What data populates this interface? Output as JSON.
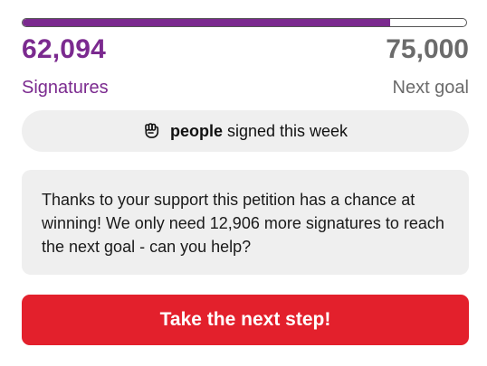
{
  "progress": {
    "fraction": 0.828,
    "fill_color": "#7b2a8f"
  },
  "stats": {
    "signatures_count": "62,094",
    "signatures_label": "Signatures",
    "goal_count": "75,000",
    "goal_label": "Next goal"
  },
  "weekly": {
    "icon": "raised-fist-icon",
    "strong_text": "people",
    "text": "signed this week"
  },
  "message": {
    "text": "Thanks to your support this petition has a chance at winning! We only need 12,906 more signatures to reach the next goal - can you help?"
  },
  "cta": {
    "label": "Take the next step!",
    "color": "#e3202c"
  }
}
